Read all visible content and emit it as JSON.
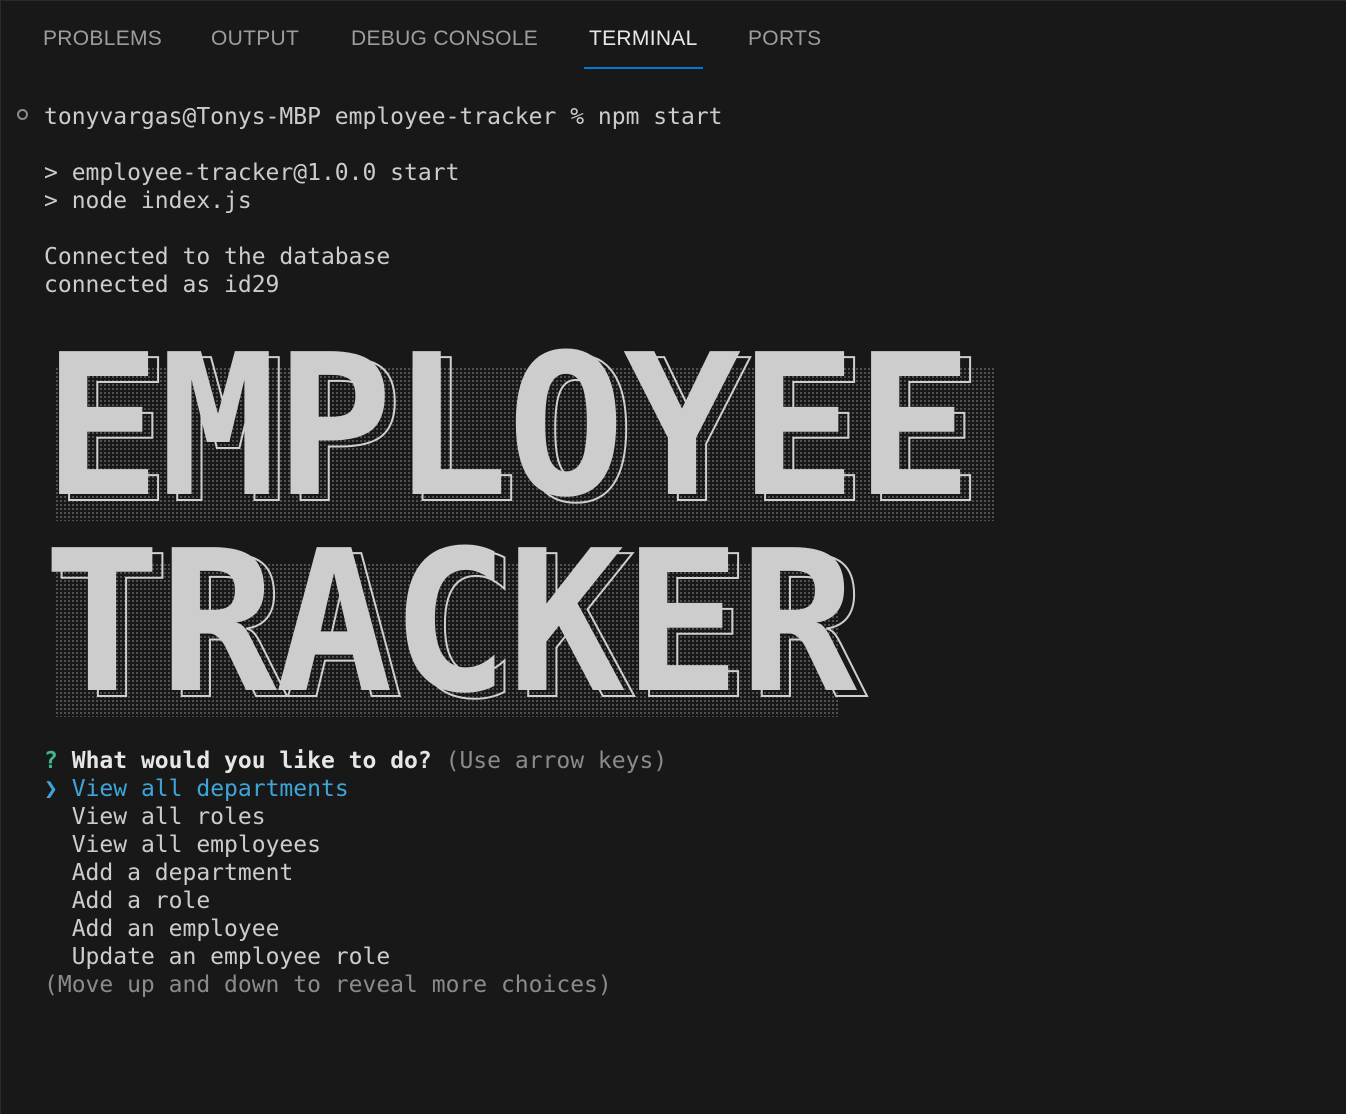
{
  "tabs": [
    {
      "label": "PROBLEMS",
      "active": false
    },
    {
      "label": "OUTPUT",
      "active": false
    },
    {
      "label": "DEBUG CONSOLE",
      "active": false
    },
    {
      "label": "TERMINAL",
      "active": true
    },
    {
      "label": "PORTS",
      "active": false
    }
  ],
  "terminal": {
    "prompt_line": "tonyvargas@Tonys-MBP employee-tracker % npm start",
    "script_line_1": "> employee-tracker@1.0.0 start",
    "script_line_2": "> node index.js",
    "status_line_1": "Connected to the database",
    "status_line_2": "connected as id29",
    "banner_line_1": "EMPLOYEE",
    "banner_line_2": "TRACKER",
    "question_mark": "?",
    "question": "What would you like to do?",
    "hint": "(Use arrow keys)",
    "pointer": "❯",
    "choices": [
      "View all departments",
      "View all roles",
      "View all employees",
      "Add a department",
      "Add a role",
      "Add an employee",
      "Update an employee role"
    ],
    "more_hint": "(Move up and down to reveal more choices)"
  },
  "colors": {
    "background": "#181818",
    "active_tab_underline": "#0078d4",
    "selected_choice": "#3ea5d9",
    "question_mark": "#3fb68b"
  }
}
